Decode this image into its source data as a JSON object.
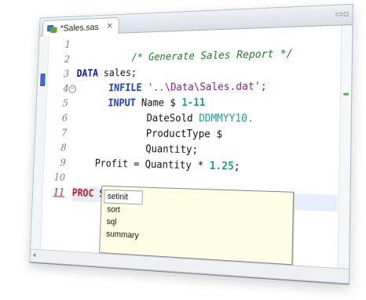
{
  "tab": {
    "title": "*Sales.sas",
    "close_glyph": "✕"
  },
  "window_controls": {
    "restore_glyph": "▭▫"
  },
  "editor": {
    "line_numbers": [
      "1",
      "2",
      "3",
      "4",
      "5",
      "6",
      "7",
      "8",
      "9",
      "10",
      "11"
    ],
    "current_line": 11,
    "fold_glyph": "−"
  },
  "code": {
    "l1_comment": "/* Generate Sales Report */",
    "l3_kw": "DATA",
    "l3_rest": " sales;",
    "l4_kw": "INFILE",
    "l4_str": " '..\\Data\\Sales.dat';",
    "l5_kw": "INPUT",
    "l5_rest": " Name $ ",
    "l5_num": "1-11",
    "l6_var": "DateSold ",
    "l6_fmt": "DDMMYY10.",
    "l7_rest": "ProductType $",
    "l8_rest": "Quantity;",
    "l9_rest": "Profit = Quantity * ",
    "l9_num": "1.25",
    "l9_end": ";",
    "l11_kw": "PROC",
    "l11_rest": " S"
  },
  "content_assist": {
    "items": [
      "setinit",
      "sort",
      "sql",
      "summary"
    ],
    "selected_index": 0
  },
  "icons": {
    "file": "sas-file-icon",
    "close": "close-icon",
    "bookmark": "bookmark-icon",
    "fold": "fold-collapse-icon",
    "scroll_left": "scroll-left-icon"
  },
  "colors": {
    "comment": "#1f7a25",
    "keyword": "#0a1f9e",
    "proc_keyword": "#c21d1d",
    "number": "#1b9a8a",
    "assist_background": "#fefde5"
  },
  "hscroll": {
    "left_glyph": "◂"
  }
}
